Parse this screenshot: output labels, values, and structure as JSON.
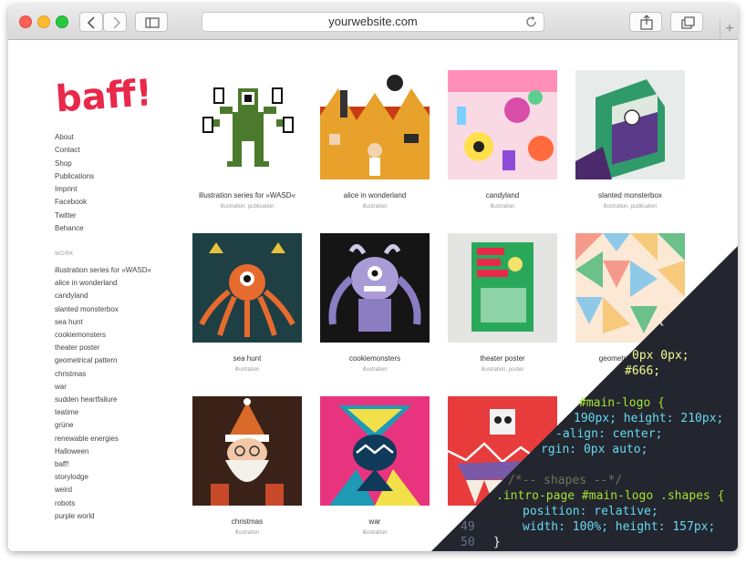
{
  "browser": {
    "url": "yourwebsite.com",
    "new_tab_label": "+"
  },
  "site": {
    "logo_text": "baff!",
    "logo_color": "#e8294a",
    "nav": [
      "About",
      "Contact",
      "Shop",
      "Publications",
      "Imprint",
      "Facebook",
      "Twitter",
      "Behance"
    ],
    "work_heading": "WORK",
    "work_list": [
      "illustration series for »WASD«",
      "alice in wonderland",
      "candyland",
      "slanted monsterbox",
      "sea hunt",
      "cookiemonsters",
      "theater poster",
      "geometrical pattern",
      "christmas",
      "war",
      "sudden heartfailure",
      "teatime",
      "grüne",
      "renewable energies",
      "Halloween",
      "baff!",
      "storylodge",
      "weird",
      "robots",
      "purple world"
    ]
  },
  "tiles": [
    {
      "title": "illustration series for »WASD«",
      "tags": "illustration, publication"
    },
    {
      "title": "alice in wonderland",
      "tags": "illustration"
    },
    {
      "title": "candyland",
      "tags": "illustration"
    },
    {
      "title": "slanted monsterbox",
      "tags": "illustration, publication"
    },
    {
      "title": "sea hunt",
      "tags": "illustration"
    },
    {
      "title": "cookiemonsters",
      "tags": "illustration"
    },
    {
      "title": "theater poster",
      "tags": "illustration, poster"
    },
    {
      "title": "geometrical pattern",
      "tags": ""
    },
    {
      "title": "christmas",
      "tags": "illustration"
    },
    {
      "title": "war",
      "tags": "illustration"
    },
    {
      "title": "",
      "tags": ""
    }
  ],
  "code": {
    "line_numbers": [
      "49",
      "50"
    ],
    "lines": [
      "{",
      "0px 0px;",
      "#666;",
      "#main-logo {",
      "190px; height: 210px;",
      "-align: center;",
      "rgin: 0px auto;",
      "/*-- shapes --*/",
      ".intro-page #main-logo .shapes {",
      "position: relative;",
      "width: 100%; height: 157px;",
      "}"
    ],
    "colors": {
      "background": "#23262f",
      "selector": "#f1fa8c",
      "property": "#66d9ef",
      "number": "#f1fa8c",
      "keyword": "#a6e22e",
      "text": "#f8f8f2",
      "comment": "#75715e",
      "line_number": "#6c7086"
    }
  }
}
